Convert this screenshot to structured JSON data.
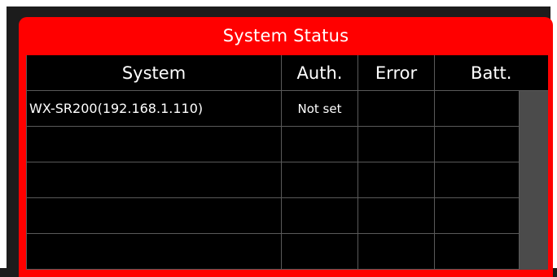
{
  "panel": {
    "title": "System Status",
    "accent_color": "#ff0000"
  },
  "table": {
    "headers": {
      "system": "System",
      "auth": "Auth.",
      "error": "Error",
      "batt": "Batt."
    },
    "rows": [
      {
        "system": "WX-SR200(192.168.1.110)",
        "auth": "Not set",
        "error": "",
        "batt": ""
      },
      {
        "system": "",
        "auth": "",
        "error": "",
        "batt": ""
      },
      {
        "system": "",
        "auth": "",
        "error": "",
        "batt": ""
      },
      {
        "system": "",
        "auth": "",
        "error": "",
        "batt": ""
      },
      {
        "system": "",
        "auth": "",
        "error": "",
        "batt": ""
      }
    ]
  }
}
